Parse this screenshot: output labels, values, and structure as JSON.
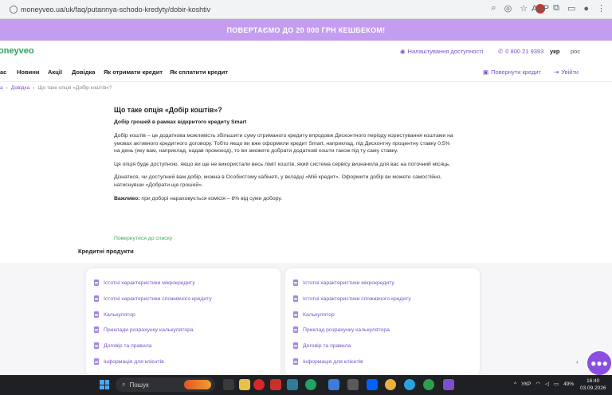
{
  "browser": {
    "url": "moneyveo.ua/uk/faq/putannya-schodo-kredyty/dobir-koshtiv",
    "extension_badge": "ABP"
  },
  "promo_banner": {
    "text": "ПОВЕРТАЄМО ДО 20 000 ГРН КЕШБЕКОМ!"
  },
  "header": {
    "logo": "oneyveo",
    "accessibility": "Налаштування доступності",
    "phone": "0 800 21 9393",
    "lang_ua": "укр",
    "lang_ru": "рос"
  },
  "nav": {
    "items": [
      "ас",
      "Новини",
      "Акції",
      "Довідка",
      "Як отримати кредит",
      "Як сплатити кредит"
    ],
    "return_credit": "Повернути кредит",
    "login": "Увійти"
  },
  "breadcrumbs": {
    "home": "а",
    "help": "Довідка",
    "current": "Що таке опція «Добір коштів»?"
  },
  "article": {
    "title": "Що таке опція «Добір коштів»?",
    "subtitle": "Добір грошей в рамках відкритого кредиту Smart",
    "p1": "Добір коштів – це додаткова можливість збільшити суму отриманого кредиту впродовж Дисконтного періоду користування коштами на умовах активного кредитного договору. Тобто якщо ви вже оформили кредит Smart, наприклад, під Дисконтну процентну ставку 0,5% на день (яку вам, наприклад, надав промокод), то ви зможете добрати додаткові кошти також під ту саму ставку.",
    "p2": "Ця опція буде доступною, якщо ви ще не використали весь ліміт коштів, який система сервісу визначила для вас на поточний місяць.",
    "p3": "Дізнатися, чи доступний вам добір, можна в Особистому кабінеті, у вкладці «Мій кредит». Оформити добір ви можете самостійно, натиснувши «Добрати ще грошей».",
    "note_label": "Важливо:",
    "note_text": " при доборі нараховується комісія – 8% від суми добору."
  },
  "back_link": "Повернутися до списку",
  "credit_section": {
    "title": "Кредитні продукти",
    "left_items": [
      "Істотні характеристики мікрокредиту",
      "Істотні характеристики споживчого кредиту",
      "Калькулятор",
      "Приклади розрахунку калькулятора",
      "Договір та правила",
      "Інформація для клієнтів"
    ],
    "right_items": [
      "Істотні характеристики мікрокредиту",
      "Істотні характеристики споживчого кредиту",
      "Калькулятор",
      "Приклад розрахунку калькулятора",
      "Договір та правила",
      "Інформація для клієнтів"
    ]
  },
  "taskbar": {
    "search_placeholder": "Пошук",
    "lang": "УКР",
    "battery": "49%",
    "time": "16:40",
    "date": "03.09.2026"
  },
  "colors": {
    "brand_purple": "#7a52c8",
    "promo": "#c59df0",
    "brand_green": "#2aa35d"
  }
}
